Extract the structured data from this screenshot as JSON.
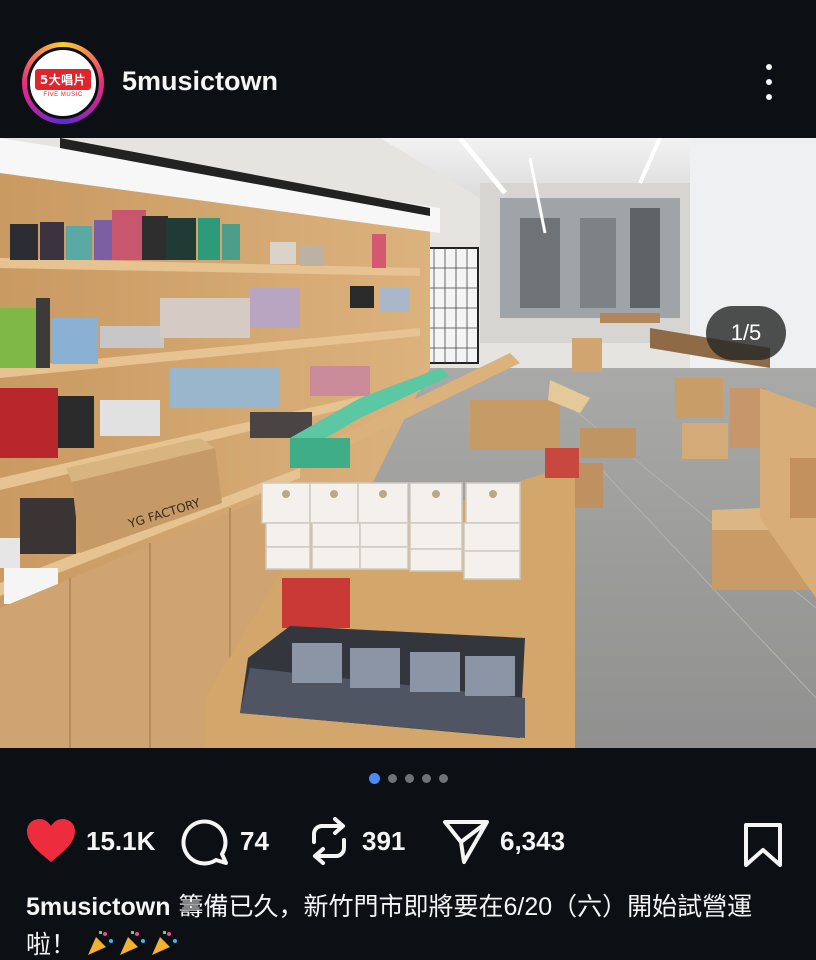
{
  "post": {
    "username": "5musictown",
    "avatar_logo_text": "5大唱片",
    "avatar_logo_subtext": "FIVE MUSIC",
    "more_icon": "more-vertical-icon",
    "image_counter": "1/5",
    "carousel": {
      "total": 5,
      "active_index": 0
    },
    "box_label": "YG FACTORY",
    "likes": "15.1K",
    "comments": "74",
    "reposts": "391",
    "shares": "6,343",
    "liked": true,
    "caption_user": "5musictown",
    "caption_text": "籌備已久，新竹門市即將要在6/20（六）開始試營運啦！",
    "caption_emoji": "party-popper-icon",
    "colors": {
      "like": "#ed2d3d",
      "active_dot": "#4a8cf7",
      "background": "#0c0f14"
    }
  }
}
